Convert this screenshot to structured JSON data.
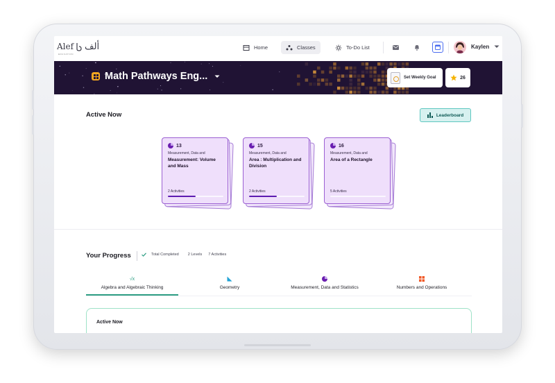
{
  "logo": {
    "text": "Alef",
    "arabic": "ألف",
    "sub": "EDUCATION"
  },
  "nav": {
    "items": [
      {
        "label": "Home",
        "icon": "home-icon"
      },
      {
        "label": "Classes",
        "icon": "classes-icon"
      },
      {
        "label": "To-Do List",
        "icon": "todo-icon"
      }
    ],
    "user": {
      "name": "Kaylen"
    }
  },
  "banner": {
    "course_title": "Math Pathways Eng...",
    "weekly_goal_label": "Set Weekly Goal",
    "stars_count": "26"
  },
  "active_now": {
    "title": "Active Now",
    "leaderboard_label": "Leaderboard",
    "cards": [
      {
        "number": "13",
        "category": "Measurement, Data and",
        "title": "Measurement: Volume and Mass",
        "activities": "2 Activities",
        "progress": 0.5
      },
      {
        "number": "15",
        "category": "Measurement, Data and",
        "title": "Area : Multiplication and Division",
        "activities": "2 Activities",
        "progress": 0.5
      },
      {
        "number": "16",
        "category": "Measurement, Data and",
        "title": "Area of a Rectangle",
        "activities": "5 Activities",
        "progress": 0.0
      }
    ]
  },
  "progress": {
    "title": "Your Progress",
    "total_completed": "Total Completed",
    "levels": "2 Levels",
    "activities": "7 Activities",
    "tabs": [
      {
        "label": "Algebra and Algebraic Thinking",
        "icon": "sqrt-icon",
        "active": true
      },
      {
        "label": "Geometry",
        "icon": "triangle-ruler-icon",
        "active": false
      },
      {
        "label": "Measurement, Data and Statistics",
        "icon": "pie-chart-icon",
        "active": false
      },
      {
        "label": "Numbers and Operations",
        "icon": "grid-icon",
        "active": false
      }
    ],
    "active_now_box_title": "Active Now"
  },
  "colors": {
    "banner_bg": "#201334",
    "accent_purple": "#5d1bb0",
    "accent_teal": "#2d9e83",
    "card_bg": "#efdffb"
  }
}
